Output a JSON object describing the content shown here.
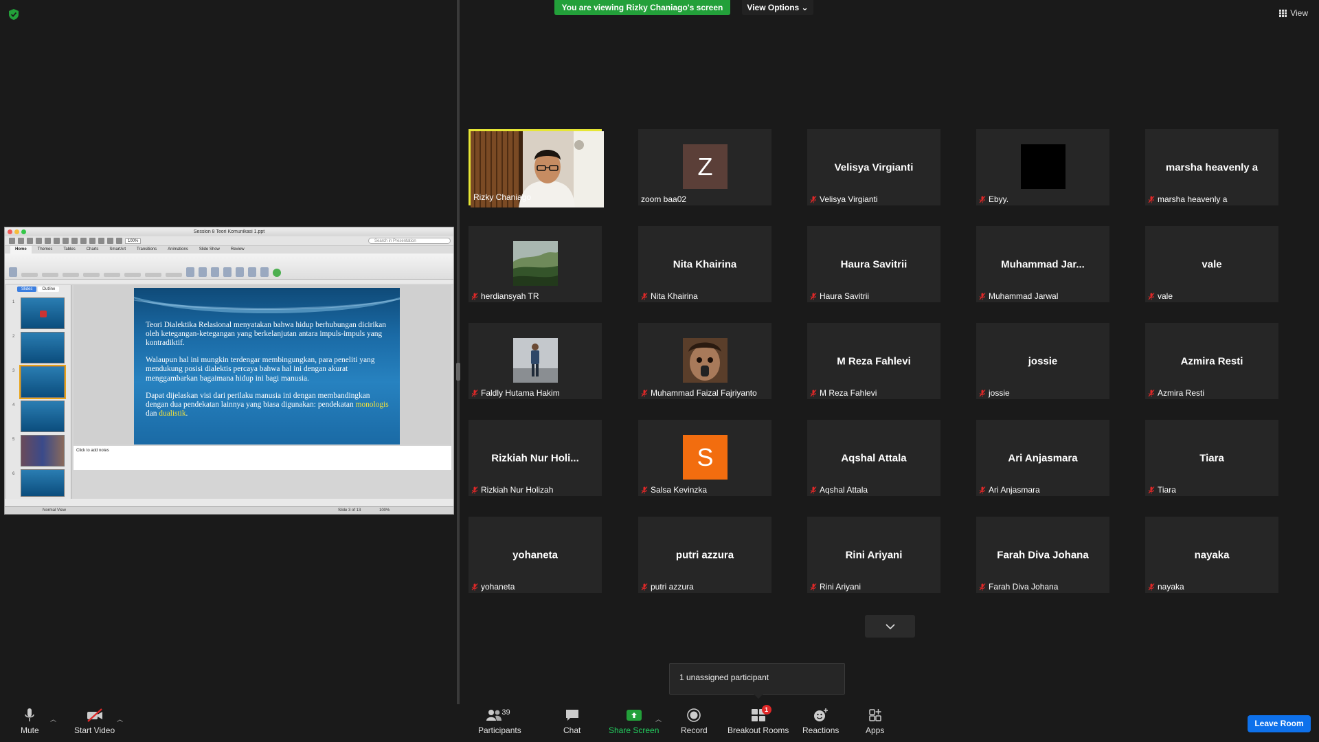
{
  "banner": {
    "viewing": "You are viewing Rizky Chaniago's screen",
    "view_options": "View Options ⌄"
  },
  "top_right": {
    "view": "View"
  },
  "ppt": {
    "title": "Session 8 Teori Komunikasi 1.ppt",
    "search_placeholder": "Search in Presentation",
    "tabs": [
      "Home",
      "Themes",
      "Tables",
      "Charts",
      "SmartArt",
      "Transitions",
      "Animations",
      "Slide Show",
      "Review"
    ],
    "slides_tab": "Slides",
    "outline_tab": "Outline",
    "paragraphs": [
      "Teori Dialektika Relasional menyatakan bahwa hidup berhubungan dicirikan oleh ketegangan-ketegangan yang berkelanjutan antara impuls-impuls yang kontradiktif.",
      "Walaupun hal ini mungkin terdengar membingungkan, para peneliti yang mendukung posisi dialektis percaya bahwa hal ini dengan akurat menggambarkan bagaimana hidup ini bagi manusia."
    ],
    "p3_pre": "Dapat dijelaskan visi dari perilaku manusia ini dengan membandingkan dengan dua pendekatan lainnya yang biasa digunakan: pendekatan ",
    "p3_hl1": "monologis",
    "p3_mid": " dan ",
    "p3_hl2": "dualistik",
    "p3_end": ".",
    "notes_placeholder": "Click to add notes",
    "status_view": "Normal View",
    "status_slide": "Slide 3 of 13",
    "status_zoom": "100%",
    "zoom_box": "100%"
  },
  "participants": [
    {
      "display": "",
      "label": "Rizky Chaniago",
      "muted": false,
      "type": "video"
    },
    {
      "display": "",
      "label": "zoom baa02",
      "muted": false,
      "type": "avatar",
      "letter": "Z",
      "color": "#5b3f38"
    },
    {
      "display": "Velisya Virgianti",
      "label": "Velisya Virgianti",
      "muted": true,
      "type": "name"
    },
    {
      "display": "",
      "label": "Ebyy.",
      "muted": true,
      "type": "black"
    },
    {
      "display": "marsha heavenly a",
      "label": "marsha heavenly a",
      "muted": true,
      "type": "name"
    },
    {
      "display": "",
      "label": "herdiansyah TR",
      "muted": true,
      "type": "photo-forest"
    },
    {
      "display": "Nita Khairina",
      "label": "Nita Khairina",
      "muted": true,
      "type": "name"
    },
    {
      "display": "Haura Savitrii",
      "label": "Haura Savitrii",
      "muted": true,
      "type": "name"
    },
    {
      "display": "Muhammad Jar...",
      "label": "Muhammad Jarwal",
      "muted": true,
      "type": "name"
    },
    {
      "display": "vale",
      "label": "vale",
      "muted": true,
      "type": "name"
    },
    {
      "display": "",
      "label": "Faldly Hutama Hakim",
      "muted": true,
      "type": "photo-person"
    },
    {
      "display": "",
      "label": "Muhammad Faizal Fajriyanto",
      "muted": true,
      "type": "photo-face"
    },
    {
      "display": "M Reza Fahlevi",
      "label": "M Reza Fahlevi",
      "muted": true,
      "type": "name"
    },
    {
      "display": "jossie",
      "label": "jossie",
      "muted": true,
      "type": "name"
    },
    {
      "display": "Azmira Resti",
      "label": "Azmira Resti",
      "muted": true,
      "type": "name"
    },
    {
      "display": "Rizkiah Nur Holi...",
      "label": "Rizkiah Nur Holizah",
      "muted": true,
      "type": "name"
    },
    {
      "display": "",
      "label": "Salsa Kevinzka",
      "muted": true,
      "type": "avatar",
      "letter": "S",
      "color": "#f26d0f"
    },
    {
      "display": "Aqshal Attala",
      "label": "Aqshal Attala",
      "muted": true,
      "type": "name"
    },
    {
      "display": "Ari Anjasmara",
      "label": "Ari Anjasmara",
      "muted": true,
      "type": "name"
    },
    {
      "display": "Tiara",
      "label": "Tiara",
      "muted": true,
      "type": "name"
    },
    {
      "display": "yohaneta",
      "label": "yohaneta",
      "muted": true,
      "type": "name"
    },
    {
      "display": "putri azzura",
      "label": "putri azzura",
      "muted": true,
      "type": "name"
    },
    {
      "display": "Rini Ariyani",
      "label": "Rini Ariyani",
      "muted": true,
      "type": "name"
    },
    {
      "display": "Farah Diva Johana",
      "label": "Farah Diva Johana",
      "muted": true,
      "type": "name"
    },
    {
      "display": "nayaka",
      "label": "nayaka",
      "muted": true,
      "type": "name"
    }
  ],
  "unassigned": "1 unassigned participant",
  "toolbar": {
    "mute": "Mute",
    "start_video": "Start Video",
    "participants": "Participants",
    "participants_count": "39",
    "chat": "Chat",
    "share_screen": "Share Screen",
    "record": "Record",
    "breakout_rooms": "Breakout Rooms",
    "breakout_badge": "1",
    "reactions": "Reactions",
    "apps": "Apps",
    "leave_room": "Leave Room"
  },
  "colors": {
    "share_green": "#23a03a",
    "active_speaker": "#e6e635",
    "leave_blue": "#0e71eb",
    "mute_red": "#e02828"
  }
}
